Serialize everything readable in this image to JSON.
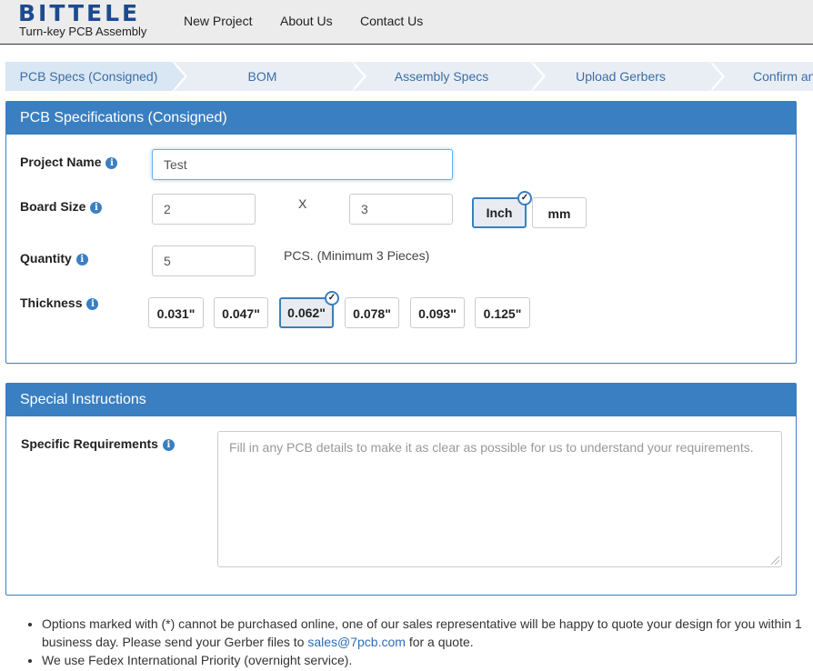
{
  "header": {
    "logo_word": "BITTELE",
    "logo_tagline": "Turn-key PCB Assembly",
    "nav": [
      "New Project",
      "About Us",
      "Contact Us"
    ]
  },
  "steps": [
    "PCB Specs (Consigned)",
    "BOM",
    "Assembly Specs",
    "Upload Gerbers",
    "Confirm an"
  ],
  "active_step": "PCB Specs (Consigned)",
  "pcb_panel": {
    "title": "PCB Specifications  (Consigned)",
    "project_name": {
      "label": "Project Name",
      "value": "Test"
    },
    "board_size": {
      "label": "Board Size",
      "width": "2",
      "separator": "X",
      "height": "3",
      "units": [
        "Inch",
        "mm"
      ],
      "selected_unit": "Inch"
    },
    "quantity": {
      "label": "Quantity",
      "value": "5",
      "note": "PCS. (Minimum 3 Pieces)"
    },
    "thickness": {
      "label": "Thickness",
      "options": [
        "0.031\"",
        "0.047\"",
        "0.062\"",
        "0.078\"",
        "0.093\"",
        "0.125\""
      ],
      "selected": "0.062\""
    }
  },
  "instructions_panel": {
    "title": "Special Instructions",
    "label": "Specific Requirements",
    "placeholder": "Fill in any PCB details to make it as clear as possible for us to understand your requirements."
  },
  "notes": {
    "line1_before": "Options marked with (*) cannot be purchased online, one of our sales representative will be happy to quote your design for you within 1 business day. Please send your Gerber files to ",
    "line1_email": "sales@7pcb.com",
    "line1_after": " for a quote.",
    "line2": "We use Fedex International Priority (overnight service)."
  },
  "icons": {
    "info": "info-icon",
    "check": "checkmark-icon"
  },
  "colors": {
    "brand_blue": "#1d4b8f",
    "panel_blue": "#3a7fc1",
    "step_text": "#3a6ea5",
    "logo_accent": "#6cbf3a"
  }
}
